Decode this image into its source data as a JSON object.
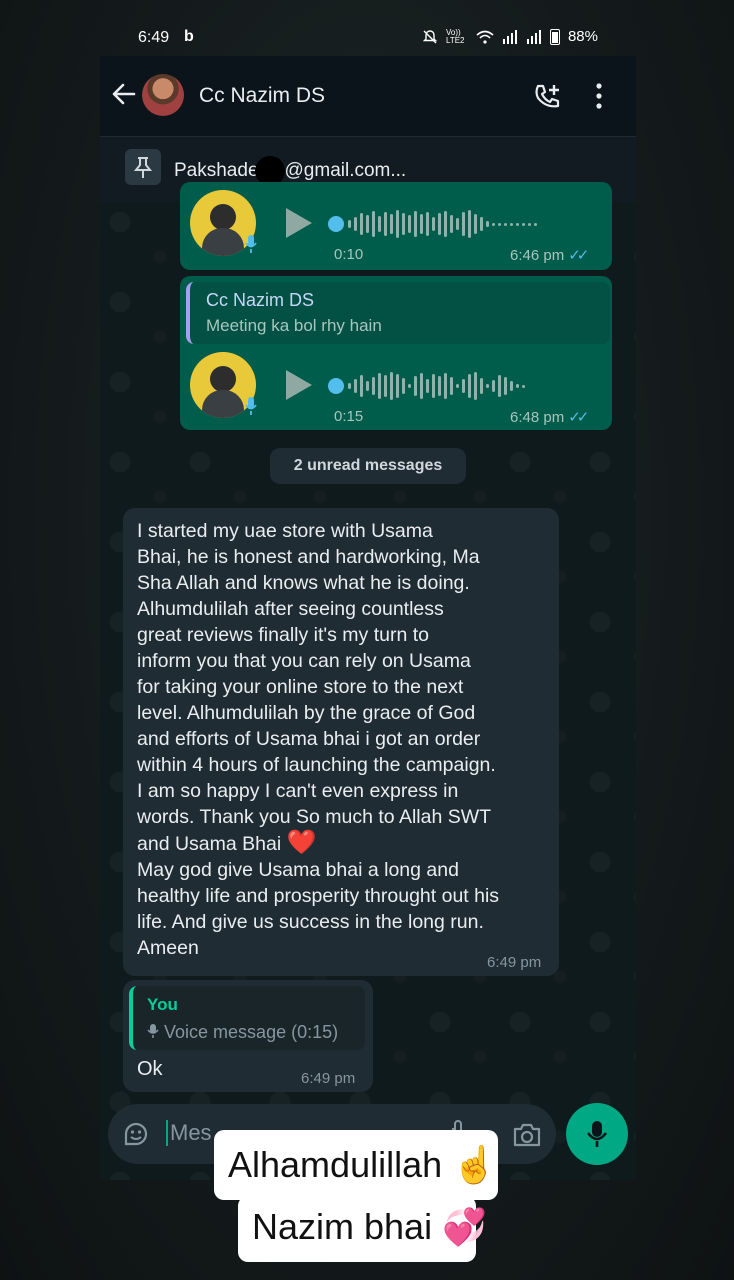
{
  "status_bar": {
    "time": "6:49",
    "carrier_icon_letter": "b",
    "network": "Vo)) LTE2",
    "battery": "88%",
    "icons": [
      "mute-icon",
      "wifi-icon",
      "signal-icon",
      "signal-icon",
      "battery-icon"
    ]
  },
  "header": {
    "contact_name": "Cc Nazim DS",
    "icons": [
      "back-arrow-icon",
      "contact-avatar",
      "add-call-icon",
      "more-vert-icon"
    ]
  },
  "pinned": {
    "text_before": "Pakshade",
    "text_after": "@gmail.com..."
  },
  "messages": {
    "voice1": {
      "duration": "0:10",
      "time": "6:46 pm",
      "ticks": "✓✓"
    },
    "voice2": {
      "quote_name": "Cc Nazim DS",
      "quote_text": "Meeting ka bol rhy hain",
      "duration": "0:15",
      "time": "6:48 pm",
      "ticks": "✓✓"
    },
    "unread_label": "2 unread messages",
    "incoming": {
      "text": "I started my uae store with Usama\nBhai, he is honest and hardworking, Ma\nSha Allah and knows what he is doing.\nAlhumdulilah after seeing countless\ngreat reviews finally it's my turn to\ninform you that you can rely on Usama\nfor taking your online store to the next\nlevel. Alhumdulilah by the grace of God\nand efforts of Usama bhai i got an order\nwithin 4 hours of launching the campaign.\nI am so happy I can't even express in\nwords. Thank you So much to Allah SWT\nand Usama Bhai",
      "heart": "❤️",
      "text2": "May god give Usama bhai a long and\nhealthy life and prosperity throught out his\nlife. And give us success in the long run.\nAmeen",
      "time": "6:49 pm"
    },
    "reply": {
      "you_label": "You",
      "voice_label": "Voice message (0:15)",
      "text": "Ok",
      "time": "6:49 pm"
    }
  },
  "input": {
    "placeholder": "Mes"
  },
  "overlay": {
    "line1": "Alhamdulillah ☝️",
    "line2": "Nazim bhai 💞"
  },
  "colors": {
    "outgoing_bubble": "#005c4b",
    "incoming_bubble": "#202c33",
    "accent_green": "#00a884",
    "read_ticks": "#53bdeb"
  }
}
